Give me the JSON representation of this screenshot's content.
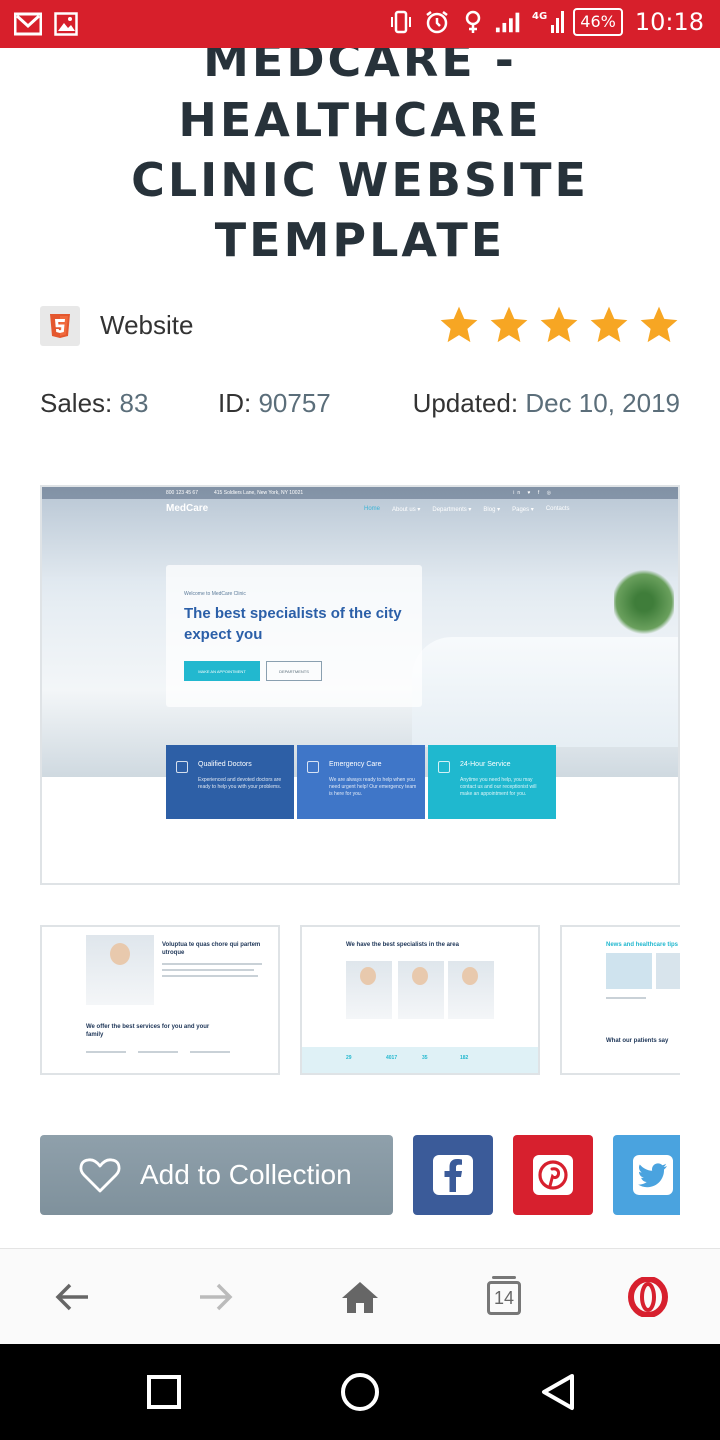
{
  "status_bar": {
    "time": "10:18",
    "battery": "46%",
    "network": "4G"
  },
  "product": {
    "title_lines": [
      "MEDCARE - HEALTHCARE",
      "CLINIC WEBSITE",
      "TEMPLATE"
    ],
    "type": "Website",
    "type_icon": "html5-icon",
    "rating": 5,
    "sales_label": "Sales:",
    "sales_value": "83",
    "id_label": "ID:",
    "id_value": "90757",
    "updated_label": "Updated:",
    "updated_value": "Dec 10, 2019"
  },
  "preview": {
    "top_phone": "800 123 45 67",
    "top_address": "415 Soldiers Lane, New York, NY 10021",
    "top_social": "in ♥ f ◎",
    "logo": "MedCare",
    "nav": [
      "Home",
      "About us ▾",
      "Departments ▾",
      "Blog ▾",
      "Pages ▾",
      "Contacts"
    ],
    "kicker": "Welcome to MedCare Clinic",
    "headline": "The best specialists of the city expect you",
    "btn_primary": "MAKE AN APPOINTMENT",
    "btn_secondary": "DEPARTMENTS",
    "features": [
      {
        "title": "Qualified Doctors",
        "text": "Experienced and devoted doctors are ready to help you with your problems."
      },
      {
        "title": "Emergency Care",
        "text": "We are always ready to help when you need urgent help! Our emergency team is here for you."
      },
      {
        "title": "24-Hour Service",
        "text": "Anytime you need help, you may contact us and our receptionist will make an appointment for you."
      }
    ]
  },
  "thumbnails": [
    {
      "heading": "Voluptua te quas chore qui partem utroque",
      "subheading": "We offer the best services for you and your family"
    },
    {
      "heading": "We have the best specialists in the area",
      "stats": [
        "29",
        "4017",
        "35",
        "182"
      ]
    },
    {
      "heading": "News and healthcare tips",
      "subheading": "What our patients say"
    }
  ],
  "actions": {
    "add_label": "Add to Collection",
    "share": [
      "facebook",
      "pinterest",
      "twitter"
    ]
  },
  "browser": {
    "tab_count": "14"
  },
  "colors": {
    "status_bar": "#d71f2b",
    "title": "#27323a",
    "star": "#f7a623",
    "add_button": "#8a9ba6",
    "facebook": "#3b5b99",
    "pinterest": "#d7202e",
    "twitter": "#4aa3df",
    "opera": "#d7202e"
  }
}
